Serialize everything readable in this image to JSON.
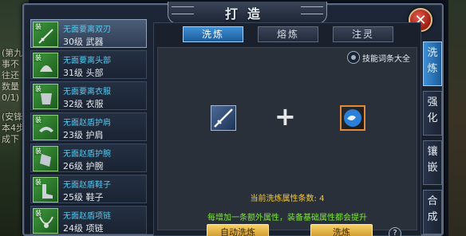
{
  "window": {
    "title": "打造",
    "close_label": "✕"
  },
  "background_text": [
    "(第九",
    "事不",
    "往还",
    "数量",
    "0/1)",
    "(安锋",
    "本4步",
    "成下"
  ],
  "items": [
    {
      "name": "无面要离双刃",
      "level": "30级 武器",
      "badge": "装"
    },
    {
      "name": "无面要离头部",
      "level": "31级 头部",
      "badge": "装"
    },
    {
      "name": "无面要离衣服",
      "level": "32级 衣服",
      "badge": "装"
    },
    {
      "name": "无面赵盾护肩",
      "level": "23级 护肩",
      "badge": "装"
    },
    {
      "name": "无面赵盾护腕",
      "level": "26级 护腕",
      "badge": "装"
    },
    {
      "name": "无面赵盾鞋子",
      "level": "25级 鞋子",
      "badge": "装"
    },
    {
      "name": "无面赵盾项链",
      "level": "24级 项链",
      "badge": "装"
    }
  ],
  "tabs": [
    "洗炼",
    "熔炼",
    "注灵"
  ],
  "active_tab": "洗炼",
  "skill_link": "技能词条大全",
  "count_label": "当前洗炼属性条数: 4",
  "hint": "每增加一条额外属性，装备基础属性都会提升",
  "buttons": {
    "auto": "自动洗炼",
    "refine": "洗炼"
  },
  "help_label": "?",
  "side_tabs": [
    "洗炼",
    "强化",
    "镶嵌",
    "合成"
  ],
  "active_side_tab": "洗炼"
}
